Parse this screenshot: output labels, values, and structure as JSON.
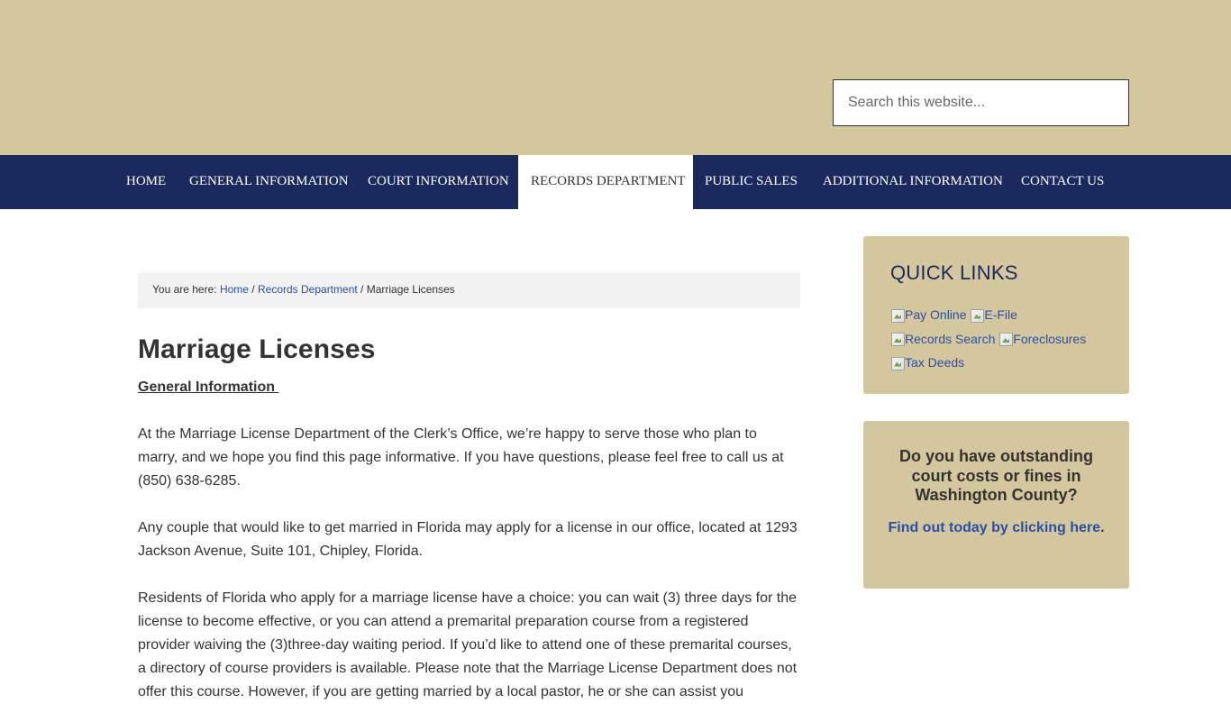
{
  "header": {
    "search_placeholder": "Search this website..."
  },
  "nav": {
    "items": [
      {
        "label": "HOME"
      },
      {
        "label": "GENERAL INFORMATION"
      },
      {
        "label": "COURT INFORMATION"
      },
      {
        "label": "RECORDS DEPARTMENT",
        "active": true
      },
      {
        "label": "PUBLIC SALES"
      },
      {
        "label": "ADDITIONAL INFORMATION"
      },
      {
        "label": "CONTACT US"
      }
    ]
  },
  "breadcrumb": {
    "prefix": "You are here: ",
    "home": "Home",
    "sep1": " / ",
    "section": "Records Department",
    "sep2": " / ",
    "current": "Marriage Licenses"
  },
  "main": {
    "title": "Marriage Licenses",
    "section_heading": "General Information ",
    "paragraphs": [
      "At the Marriage License Department of the Clerk’s Office, we’re happy to serve those who plan to marry, and we hope you find this page informative.  If you have questions, please feel free to call us at (850) 638-6285.",
      "Any couple that would like to get married in Florida may apply for a license in our office, located at 1293 Jackson Avenue, Suite 101, Chipley, Florida.",
      "Residents of Florida who apply for a marriage license have a choice:  you can wait (3) three days for the license to become effective, or you can attend a premarital preparation course from a registered provider waiving the (3)three-day waiting period.  If you’d like to attend one of these premarital courses, a directory of course providers is available.  Please note that the Marriage License Department does not offer this course.  However, if you are getting married by a local pastor, he or she can assist you"
    ]
  },
  "sidebar": {
    "quick_links_title": "QUICK LINKS",
    "quick_links": [
      {
        "label": "Pay Online",
        "icon": "broken-image-icon"
      },
      {
        "label": "E-File",
        "icon": "broken-image-icon"
      },
      {
        "label": "Records Search",
        "icon": "broken-image-icon"
      },
      {
        "label": "Foreclosures",
        "icon": "broken-image-icon"
      },
      {
        "label": "Tax Deeds",
        "icon": "broken-image-icon"
      }
    ],
    "fines": {
      "heading": "Do you have outstanding court costs or fines in Washington County?",
      "link_text": "Find out today by clicking here",
      "period": "."
    }
  },
  "colors": {
    "header_bg": "#d4c79e",
    "nav_bg": "#1b2a5e",
    "link": "#2a4fa8",
    "breadcrumb_bg": "#f2f2f2"
  }
}
